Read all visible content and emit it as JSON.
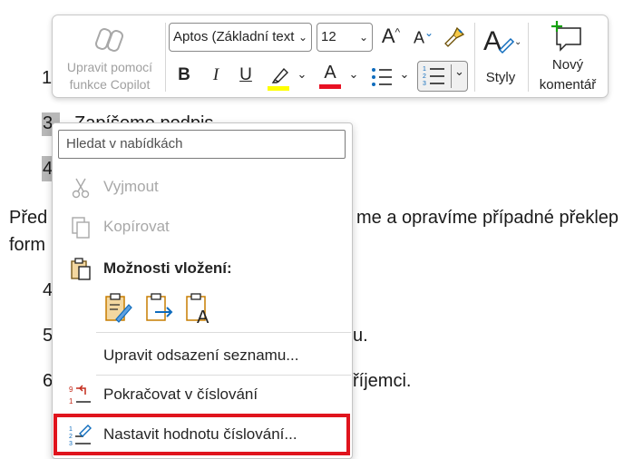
{
  "document": {
    "list_num_1": "1",
    "list_num_3": "3",
    "list_text_3": "Zapíšeme podpis",
    "list_num_4a": "4",
    "para_line_1_left": "Před",
    "para_line_1_right": "me a opravíme případné překlep",
    "para_line_2_left": "form",
    "list_num_4b": "4",
    "list_num_5": "5",
    "list_text_5_tail": "u.",
    "list_num_6": "6",
    "list_text_6_tail": "říjemci."
  },
  "toolbar": {
    "copilot_label_1": "Upravit pomocí",
    "copilot_label_2": "funkce Copilot",
    "font_name": "Aptos (Základní text",
    "font_size": "12",
    "grow_font_glyph": "A",
    "shrink_font_glyph": "A",
    "bold_glyph": "B",
    "italic_glyph": "I",
    "underline_glyph": "U",
    "font_color_glyph": "A",
    "styles_label": "Styly",
    "new_comment_label_1": "Nový",
    "new_comment_label_2": "komentář",
    "highlight_color": "#ffff00",
    "font_color": "#e81123",
    "accent_color": "#0f6cbd",
    "comment_plus_color": "#13a10e"
  },
  "context_menu": {
    "search_placeholder": "Hledat v nabídkách",
    "cut_label": "Vyjmout",
    "copy_label": "Kopírovat",
    "paste_options_label": "Možnosti vložení:",
    "adjust_indent_label": "Upravit odsazení seznamu...",
    "continue_numbering_label": "Pokračovat v číslování",
    "set_numbering_value_label": "Nastavit hodnotu číslování...",
    "annotation_box_color": "#e0141d"
  }
}
